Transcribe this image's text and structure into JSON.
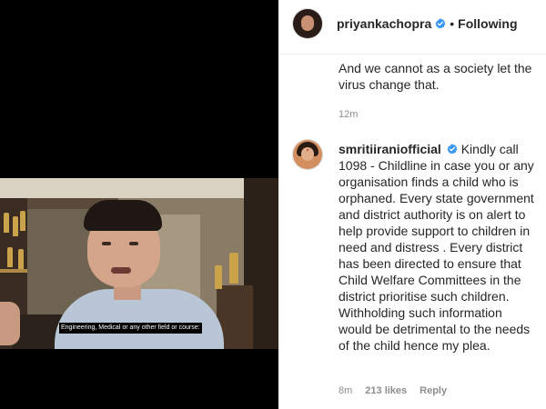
{
  "video": {
    "subtitle": "Engineering, Medical or any other field or course:"
  },
  "post": {
    "header": {
      "username": "priyankachopra",
      "separator": "•",
      "follow_state": "Following"
    },
    "caption_tail": "And we cannot as a society let the virus change that.",
    "caption_time": "12m"
  },
  "comment": {
    "username": "smritiiraniofficial",
    "text": "Kindly call 1098 - Childline in case you or any organisation finds a child who is orphaned. Every state government and district authority is on alert to help provide support to children in need and distress . Every district has been directed to ensure that Child Welfare Committees in the district prioritise such children. Withholding such information would be detrimental to the needs of the child hence my plea.",
    "time": "8m",
    "likes": "213 likes",
    "reply_label": "Reply"
  },
  "icons": {
    "verified": "verified-badge-icon"
  },
  "colors": {
    "verified_blue": "#3897f0",
    "text_primary": "#262626",
    "text_secondary": "#8e8e8e",
    "media_background": "#000000"
  }
}
